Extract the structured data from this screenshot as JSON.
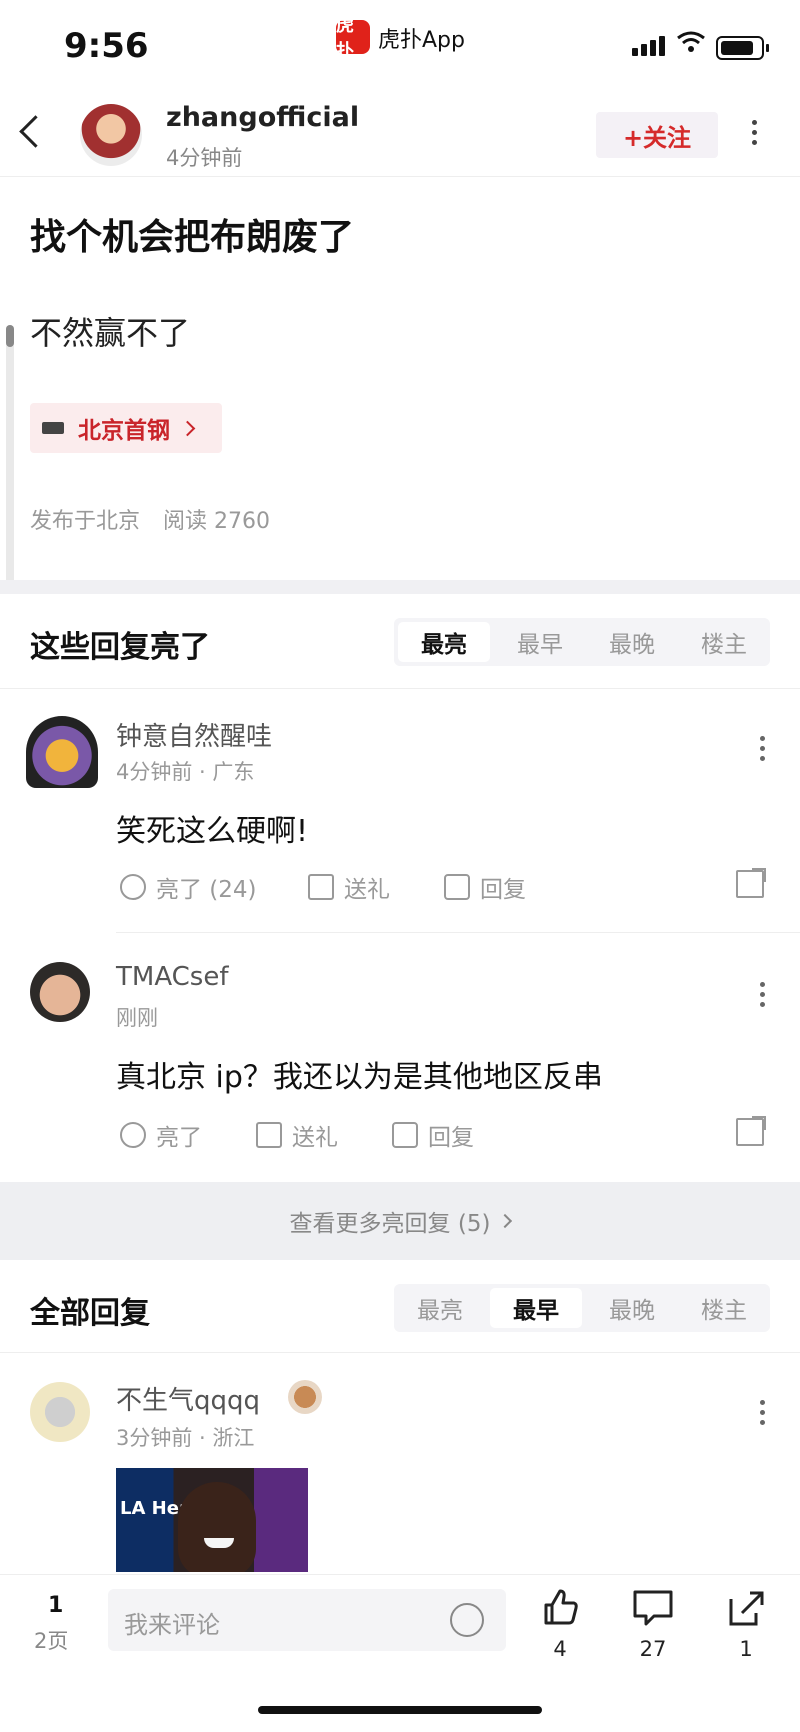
{
  "status": {
    "time": "9:56",
    "app_name": "虎扑App",
    "app_logo_text": "虎扑"
  },
  "header": {
    "username": "zhangofficial",
    "time_ago": "4分钟前",
    "follow_label": "+关注"
  },
  "post": {
    "title": "找个机会把布朗废了",
    "body": "不然赢不了",
    "tag": "北京首钢",
    "location": "发布于北京",
    "read_label": "阅读 2760"
  },
  "highlight": {
    "title": "这些回复亮了",
    "tabs": [
      "最亮",
      "最早",
      "最晚",
      "楼主"
    ],
    "active_tab": "最亮",
    "comments": [
      {
        "name": "钟意自然醒哇",
        "sub": "4分钟前 · 广东",
        "text": "笑死这么硬啊!",
        "light": "亮了 (24)",
        "gift": "送礼",
        "reply": "回复"
      },
      {
        "name": "TMACsef",
        "sub": "刚刚",
        "text": "真北京 ip？我还以为是其他地区反串",
        "light": "亮了",
        "gift": "送礼",
        "reply": "回复"
      }
    ],
    "more": "查看更多亮回复 (5)"
  },
  "all": {
    "title": "全部回复",
    "tabs": [
      "最亮",
      "最早",
      "最晚",
      "楼主"
    ],
    "active_tab": "最早",
    "comments": [
      {
        "name": "不生气qqqq",
        "sub": "3分钟前 · 浙江",
        "image_text": "LA Health"
      }
    ]
  },
  "bottom": {
    "page_num": "1",
    "page_label": "2页",
    "input_placeholder": "我来评论",
    "like_count": "4",
    "comment_count": "27",
    "share_count": "1"
  },
  "colors": {
    "accent": "#d52a2a",
    "tag_bg": "#fbeced",
    "separator": "#f0f0f3"
  }
}
